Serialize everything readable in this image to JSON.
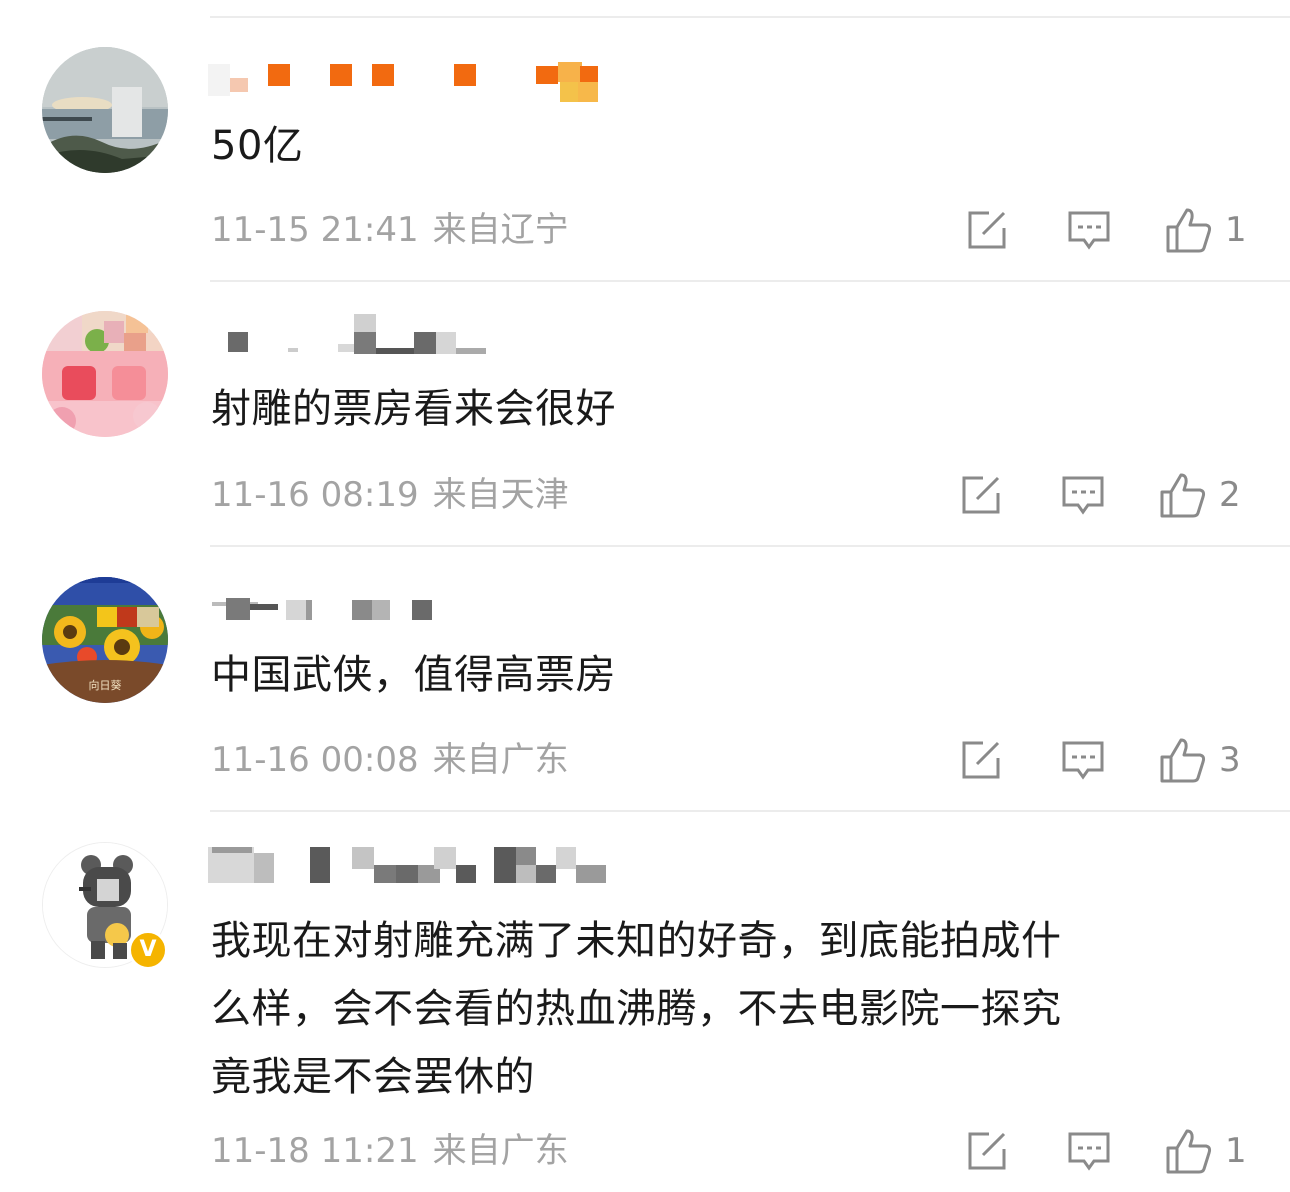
{
  "comments": [
    {
      "content": "50亿",
      "time": "11-15 21:41",
      "location": "来自辽宁",
      "likes": "1",
      "verified": false,
      "avatar_icon": "landscape-avatar-icon"
    },
    {
      "content": "射雕的票房看来会很好",
      "time": "11-16 08:19",
      "location": "来自天津",
      "likes": "2",
      "verified": false,
      "avatar_icon": "pink-toy-avatar-icon"
    },
    {
      "content": "中国武侠，值得高票房",
      "time": "11-16 00:08",
      "location": "来自广东",
      "likes": "3",
      "verified": false,
      "avatar_icon": "sunflower-avatar-icon",
      "avatar_caption": "向日葵"
    },
    {
      "content": "我现在对射雕充满了未知的好奇，到底能拍成什么样，会不会看的热血沸腾，不去电影院一探究竟我是不会罢休的",
      "content_lines": [
        "我现在对射雕充满了未知的好奇，到底能拍成什",
        "么样，会不会看的热血沸腾，不去电影院一探究",
        "竟我是不会罢休的"
      ],
      "time": "11-18 11:21",
      "location": "来自广东",
      "likes": "1",
      "verified": true,
      "verified_mark": "V",
      "avatar_icon": "cartoon-bear-avatar-icon"
    }
  ],
  "icons": {
    "repost": "repost-icon",
    "comment": "comment-icon",
    "like": "thumbs-up-icon"
  },
  "colors": {
    "text": "#1a1a1a",
    "meta": "#a3a3a3",
    "icon": "#8a8a8a",
    "divider": "#ececec",
    "verified_badge": "#f5b400"
  }
}
